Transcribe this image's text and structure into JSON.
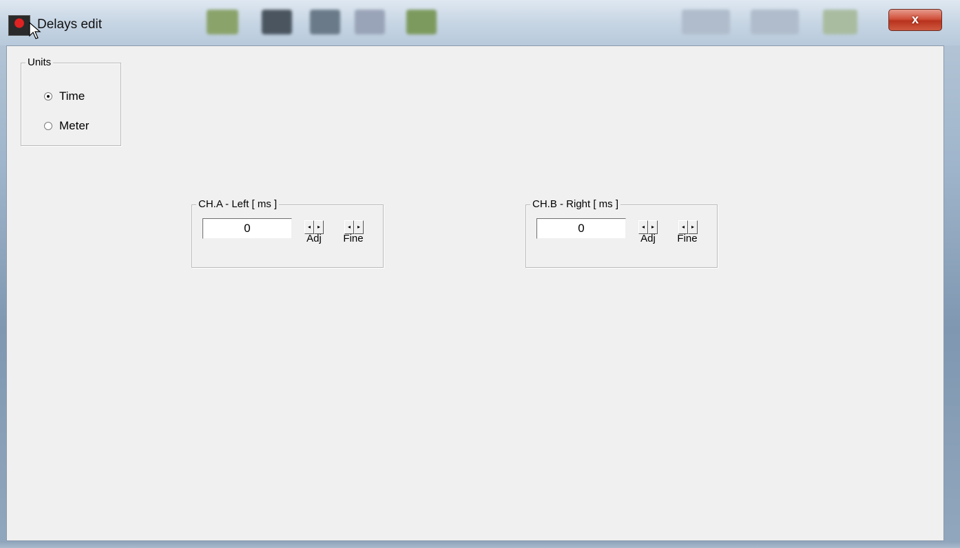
{
  "window": {
    "title": "Delays edit",
    "close_glyph": "x"
  },
  "units": {
    "label": "Units",
    "options": [
      {
        "label": "Time",
        "selected": true
      },
      {
        "label": "Meter",
        "selected": false
      }
    ]
  },
  "channels": [
    {
      "label": "CH.A - Left [ ms ]",
      "value": "0",
      "adj_label": "Adj",
      "fine_label": "Fine"
    },
    {
      "label": "CH.B - Right [ ms ]",
      "value": "0",
      "adj_label": "Adj",
      "fine_label": "Fine"
    }
  ],
  "icons": {
    "app": "speaker-app-icon",
    "spin_left": "◂",
    "spin_right": "▸"
  }
}
